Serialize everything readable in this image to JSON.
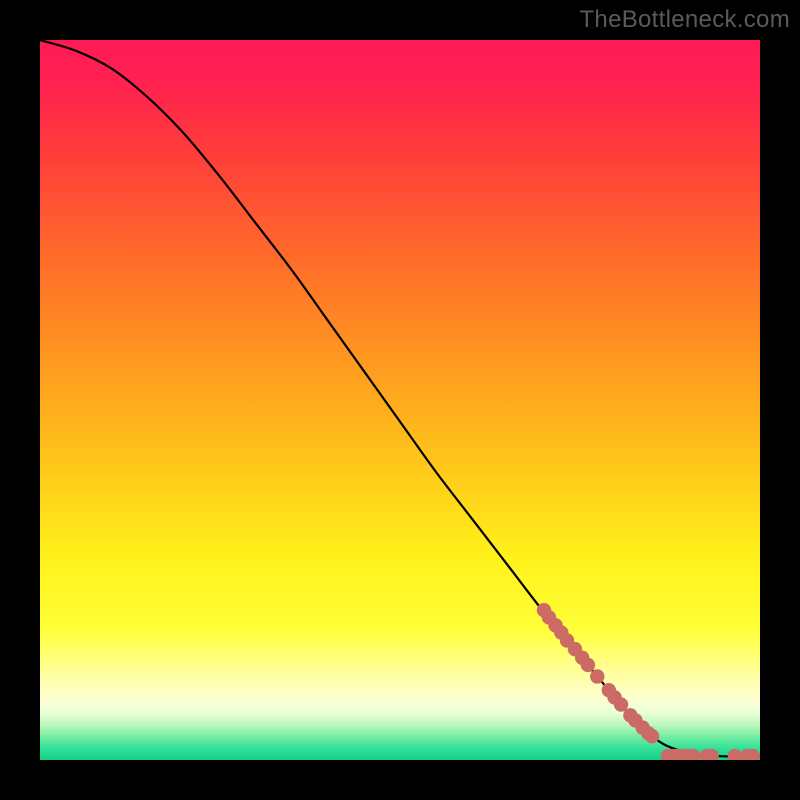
{
  "watermark": "TheBottleneck.com",
  "chart_data": {
    "type": "line",
    "title": "",
    "xlabel": "",
    "ylabel": "",
    "xlim": [
      0,
      100
    ],
    "ylim": [
      0,
      100
    ],
    "curve": {
      "name": "bottleneck-curve",
      "x": [
        0,
        5,
        10,
        15,
        20,
        25,
        30,
        35,
        40,
        45,
        50,
        55,
        60,
        65,
        70,
        75,
        80,
        83,
        85,
        87,
        90,
        93,
        96,
        100
      ],
      "y": [
        100,
        98.5,
        96,
        92,
        87,
        81,
        74.5,
        68,
        61,
        54,
        47,
        40,
        33.5,
        27,
        20.5,
        14.5,
        8.5,
        5,
        3.3,
        2.0,
        1.0,
        0.6,
        0.5,
        0.5
      ]
    },
    "scatter": {
      "name": "component-points",
      "points": [
        {
          "x": 70.0,
          "y": 20.8
        },
        {
          "x": 70.7,
          "y": 19.8
        },
        {
          "x": 71.6,
          "y": 18.7
        },
        {
          "x": 72.4,
          "y": 17.7
        },
        {
          "x": 73.2,
          "y": 16.6
        },
        {
          "x": 74.3,
          "y": 15.4
        },
        {
          "x": 75.3,
          "y": 14.2
        },
        {
          "x": 76.1,
          "y": 13.2
        },
        {
          "x": 77.4,
          "y": 11.6
        },
        {
          "x": 79.0,
          "y": 9.7
        },
        {
          "x": 79.8,
          "y": 8.7
        },
        {
          "x": 80.7,
          "y": 7.7
        },
        {
          "x": 82.0,
          "y": 6.2
        },
        {
          "x": 82.7,
          "y": 5.5
        },
        {
          "x": 83.7,
          "y": 4.5
        },
        {
          "x": 84.5,
          "y": 3.7
        },
        {
          "x": 85.0,
          "y": 3.3
        },
        {
          "x": 87.2,
          "y": 0.55
        },
        {
          "x": 87.9,
          "y": 0.55
        },
        {
          "x": 88.5,
          "y": 0.55
        },
        {
          "x": 89.2,
          "y": 0.55
        },
        {
          "x": 90.0,
          "y": 0.55
        },
        {
          "x": 90.7,
          "y": 0.55
        },
        {
          "x": 92.6,
          "y": 0.55
        },
        {
          "x": 93.3,
          "y": 0.55
        },
        {
          "x": 96.5,
          "y": 0.55
        },
        {
          "x": 98.2,
          "y": 0.55
        },
        {
          "x": 99.0,
          "y": 0.55
        }
      ]
    },
    "gradient_stops": [
      {
        "t": 0.0,
        "color": "#ff1a55"
      },
      {
        "t": 0.06,
        "color": "#ff2150"
      },
      {
        "t": 0.15,
        "color": "#ff3b3b"
      },
      {
        "t": 0.3,
        "color": "#ff6a2a"
      },
      {
        "t": 0.45,
        "color": "#ff9a1f"
      },
      {
        "t": 0.6,
        "color": "#ffca1a"
      },
      {
        "t": 0.72,
        "color": "#fff21a"
      },
      {
        "t": 0.82,
        "color": "#ffff3a"
      },
      {
        "t": 0.88,
        "color": "#ffffa0"
      },
      {
        "t": 0.915,
        "color": "#fdffd0"
      },
      {
        "t": 0.935,
        "color": "#e8ffd8"
      },
      {
        "t": 0.952,
        "color": "#baf7ba"
      },
      {
        "t": 0.968,
        "color": "#72eca0"
      },
      {
        "t": 0.984,
        "color": "#33e09a"
      },
      {
        "t": 1.0,
        "color": "#15d088"
      }
    ],
    "point_color": "#cc6b66",
    "curve_color": "#000000"
  }
}
